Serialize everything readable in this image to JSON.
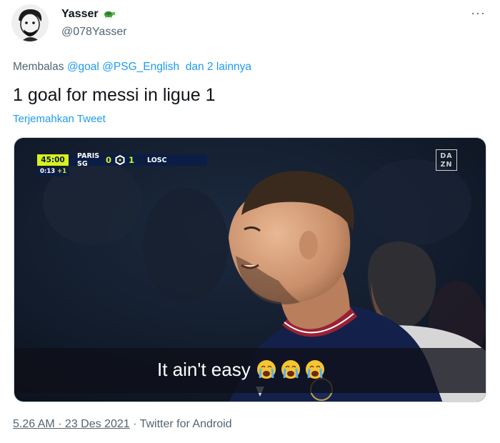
{
  "author": {
    "display_name": "Yasser",
    "badge_icon": "turtle-icon",
    "handle": "@078Yasser"
  },
  "reply": {
    "prefix": "Membalas",
    "mentions": [
      "@goal",
      "@PSG_English"
    ],
    "others": "dan 2 lainnya"
  },
  "tweet": {
    "text": "1 goal for messi in ligue 1",
    "translate_label": "Terjemahkan Tweet"
  },
  "media": {
    "scorebug": {
      "clock": "45:00",
      "home_team": "PARIS SG",
      "home_score": "0",
      "away_score": "1",
      "away_team": "LOSC",
      "added_time": "0:13",
      "added_plus": "+1"
    },
    "broadcaster_logo": "DA ZN",
    "caption": "It ain't easy",
    "caption_emoji_count": 3
  },
  "meta": {
    "timestamp": "5.26 AM · 23 Des 2021",
    "separator": "·",
    "source": "Twitter for Android"
  },
  "colors": {
    "link": "#1d9bf0",
    "secondary_text": "#536471",
    "clock_bg": "#d7f21d",
    "scorebug_bg": "#0b1d44"
  }
}
